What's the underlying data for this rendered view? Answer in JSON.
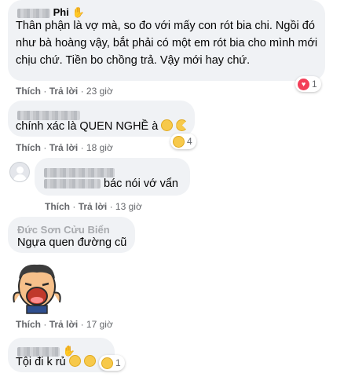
{
  "actions": {
    "like": "Thích",
    "reply": "Trả lời",
    "sep": "·"
  },
  "comments": [
    {
      "author_suffix": "Phi",
      "text": "Thân phận là vợ mà, so đo với mấy con rót bia chi. Ngồi đó như bà hoàng vậy, bắt phải có một em rót bia cho mình mới chịu chứ. Tiền bo chồng trả. Vậy mới hay chứ.",
      "time": "23 giờ",
      "reaction_count": "1"
    },
    {
      "text": "chính xác là QUEN NGHỀ à",
      "time": "18 giờ",
      "reaction_count": "4"
    },
    {
      "text": "bác nói vớ vẩn",
      "time": "13 giờ"
    },
    {
      "author": "Đức Sơn Cửu Biển",
      "text": "Ngựa quen đường cũ"
    },
    {
      "time": "17 giờ"
    },
    {
      "text": "Tội đi k rủ",
      "reaction_count": "1"
    }
  ]
}
